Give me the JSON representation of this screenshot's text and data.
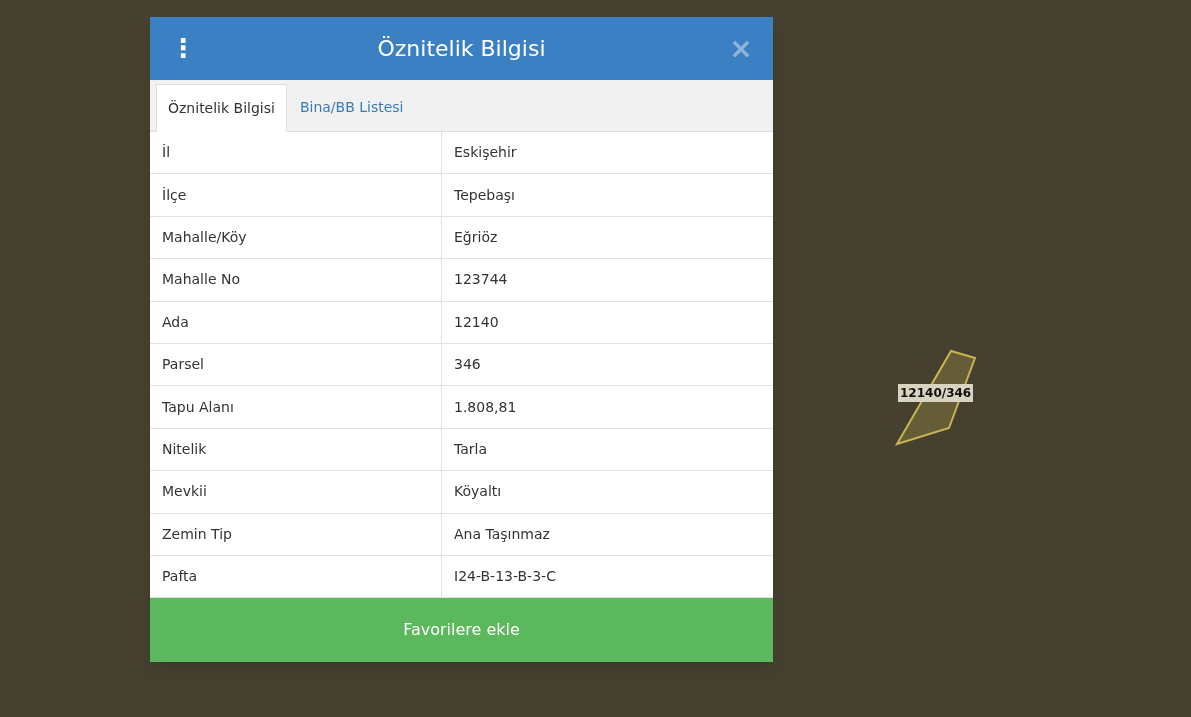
{
  "map": {
    "parcel_label": "12140/346"
  },
  "dialog": {
    "menu_icon": "⋮",
    "title": "Öznitelik Bilgisi",
    "close_icon": "×",
    "tabs": [
      {
        "label": "Öznitelik Bilgisi",
        "selected": true
      },
      {
        "label": "Bina/BB Listesi",
        "selected": false
      }
    ],
    "rows": [
      {
        "label": "İl",
        "value": "Eskişehir"
      },
      {
        "label": "İlçe",
        "value": "Tepebaşı"
      },
      {
        "label": "Mahalle/Köy",
        "value": "Eğriöz"
      },
      {
        "label": "Mahalle No",
        "value": "123744"
      },
      {
        "label": "Ada",
        "value": "12140"
      },
      {
        "label": "Parsel",
        "value": "346"
      },
      {
        "label": "Tapu Alanı",
        "value": "1.808,81"
      },
      {
        "label": "Nitelik",
        "value": "Tarla"
      },
      {
        "label": "Mevkii",
        "value": "Köyaltı"
      },
      {
        "label": "Zemin Tip",
        "value": "Ana Taşınmaz"
      },
      {
        "label": "Pafta",
        "value": "I24-B-13-B-3-C"
      }
    ],
    "button": "Favorilere ekle"
  }
}
